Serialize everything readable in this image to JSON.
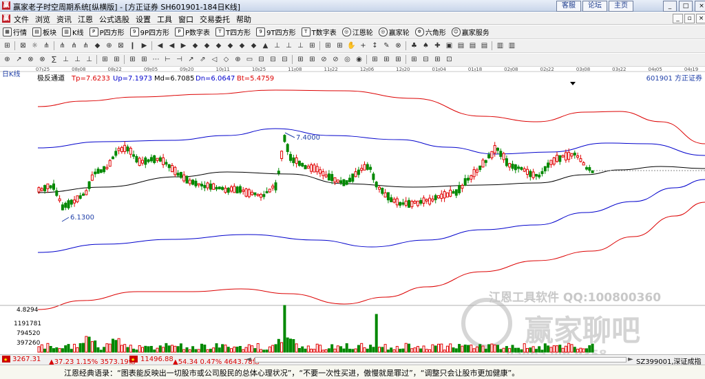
{
  "window": {
    "title": "赢家老子时空周期系统[纵横版] - [方正证券  SH601901-184日K线]",
    "icon_letter": "赢",
    "toplinks": [
      "客服",
      "论坛",
      "主页"
    ]
  },
  "menu": {
    "items": [
      "文件",
      "浏览",
      "资讯",
      "江恩",
      "公式选股",
      "设置",
      "工具",
      "窗口",
      "交易委托",
      "帮助"
    ]
  },
  "toolbar": {
    "items": [
      "行情",
      "板块",
      "K线",
      "P四方形",
      "9P四方形",
      "P数字表",
      "T四方形",
      "9T四方形",
      "T数字表",
      "江恩轮",
      "赢家轮",
      "六角形",
      "赢家服务"
    ]
  },
  "chart_data": {
    "type": "candlestick",
    "period_label": "日K线",
    "indicator": {
      "name": "极反通道",
      "Tp": "7.6233",
      "Up": "7.1973",
      "Md": "6.7085",
      "Dn": "6.0647",
      "Bt": "5.4759"
    },
    "stock_label": "601901 方正证券",
    "date_ticks": [
      "07-25",
      "08-08",
      "08-22",
      "09-05",
      "09-20",
      "10-11",
      "10-25",
      "11-08",
      "11-22",
      "12-06",
      "12-20",
      "01-04",
      "01-18",
      "02-08",
      "02-22",
      "03-08",
      "03-22",
      "04-05",
      "04-19"
    ],
    "high_label": "7.4000",
    "low_label": "6.1300",
    "volume_ticks": [
      "4.8294",
      "1191781",
      "794520",
      "397260"
    ],
    "watermark": {
      "line1": "江恩工具软件  QQ:100800360",
      "line2": "赢家聊吧",
      "line3": "jiaoba vip 9358"
    },
    "colors": {
      "up": "#e00000",
      "down": "#008800",
      "tp_bt": "#dc0000",
      "up_dn": "#0000cc",
      "md": "#000000"
    }
  },
  "status": {
    "sh_index": "3267.31",
    "sh_change": "▲37.23 1.15% 3573.19亿",
    "sz_index": "11496.88",
    "sz_change": "▲54.34 0.47% 4643.78亿",
    "right_label": "SZ399001,深证成指"
  },
  "quote": {
    "text": "江恩经典语录：“图表能反映出一切股市或公司股民的总体心理状况”，“不要一次性买进，傲慢就是罪过”，“调整只会让股市更加健康”。"
  }
}
